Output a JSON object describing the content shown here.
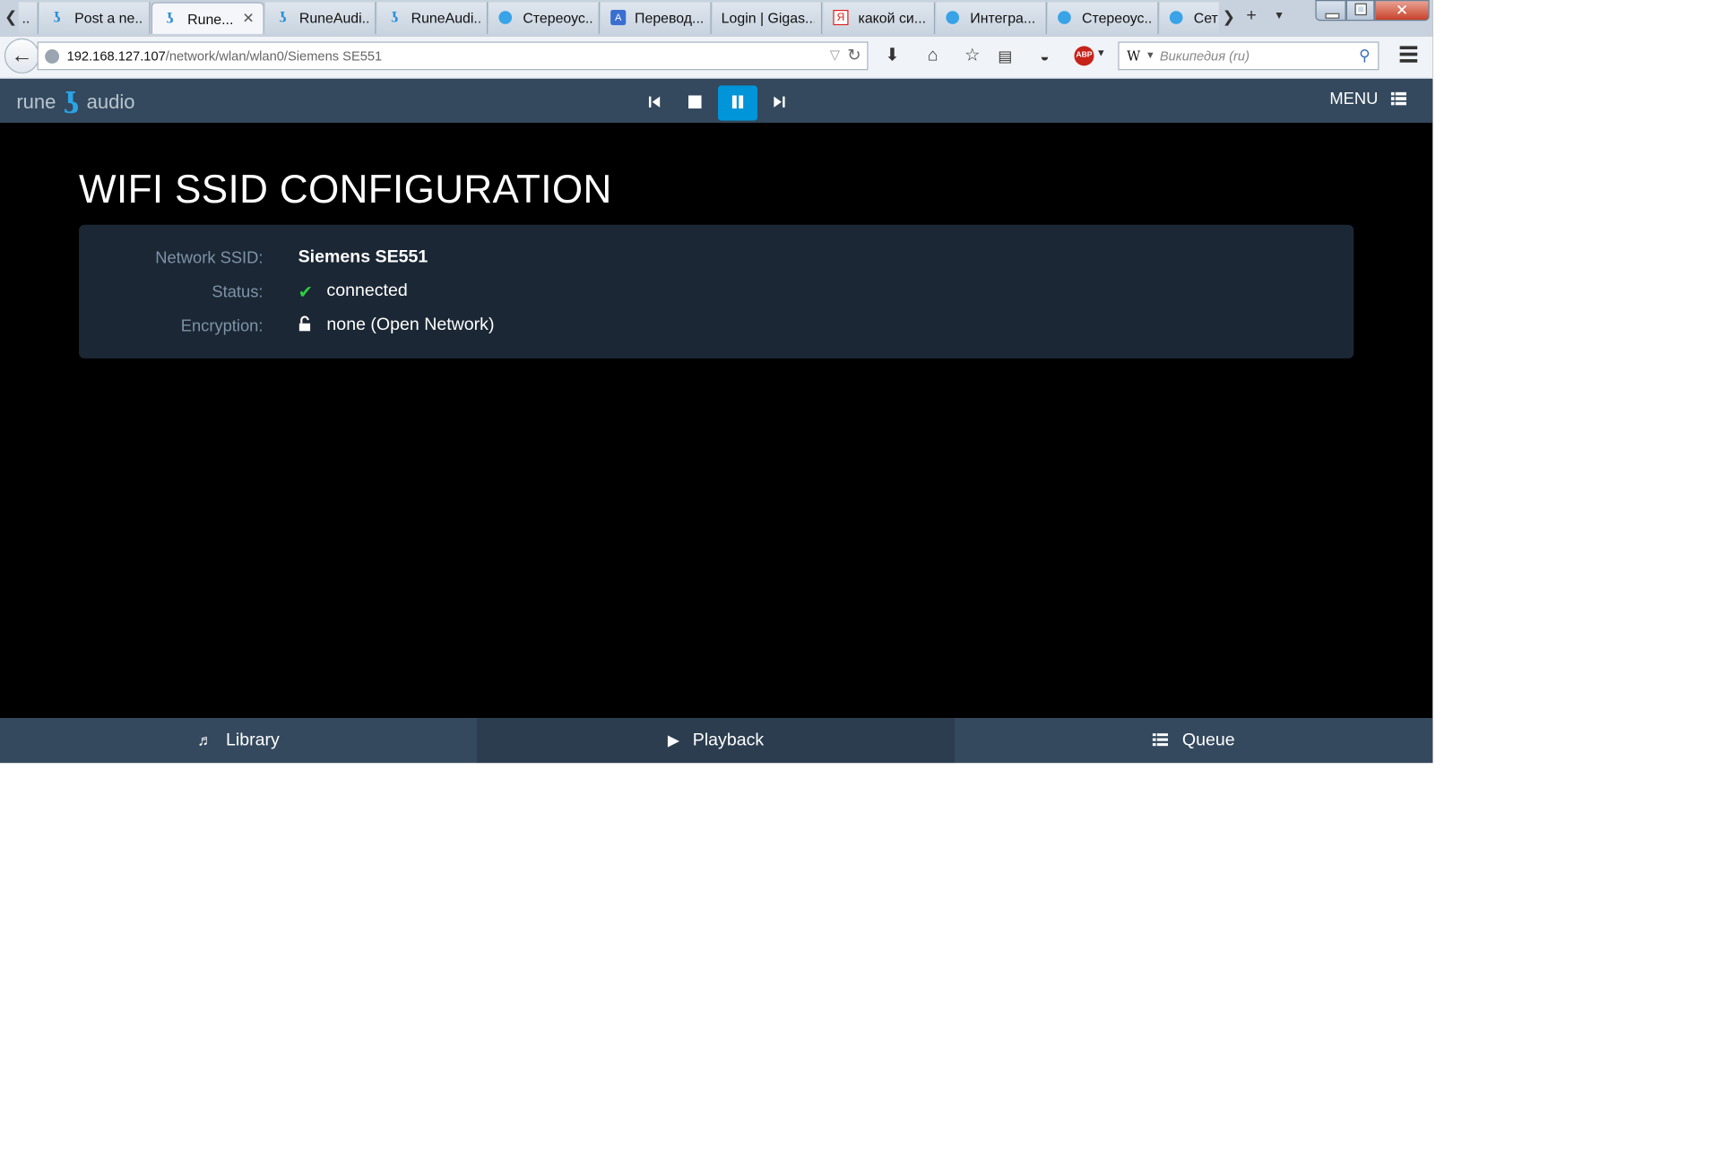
{
  "browser": {
    "tabs": [
      {
        "label": "..",
        "icon": "generic-tab-icon"
      },
      {
        "label": "Post a ne...",
        "icon": "rune-favicon-icon"
      },
      {
        "label": "Rune...",
        "icon": "rune-favicon-icon",
        "active": true
      },
      {
        "label": "RuneAudi...",
        "icon": "rune-favicon-icon"
      },
      {
        "label": "RuneAudi...",
        "icon": "rune-favicon-icon"
      },
      {
        "label": "Стереоус...",
        "icon": "globe-favicon-icon"
      },
      {
        "label": "Перевод...",
        "icon": "translate-favicon-icon"
      },
      {
        "label": "Login | Gigas...",
        "icon": "none"
      },
      {
        "label": "какой си...",
        "icon": "yandex-favicon-icon"
      },
      {
        "label": "Интегра...",
        "icon": "globe-favicon-icon"
      },
      {
        "label": "Стереоус...",
        "icon": "globe-favicon-icon"
      },
      {
        "label": "Сет",
        "icon": "globe-favicon-icon"
      }
    ],
    "tab_close_glyph": "✕",
    "new_tab_glyph": "+",
    "url": {
      "host": "192.168.127.107",
      "path": "/network/wlan/wlan0/Siemens SE551"
    },
    "search": {
      "engine_glyph": "W",
      "placeholder": "Википедия (ru)"
    },
    "abp_label": "ABP",
    "window_close_glyph": "✕"
  },
  "app": {
    "brand_left": "rune",
    "brand_right": "audio",
    "brand_mark": "ʖ",
    "menu_label": "MENU",
    "controls": [
      {
        "name": "previous-button",
        "icon": "skip-back-icon"
      },
      {
        "name": "stop-button",
        "icon": "stop-icon"
      },
      {
        "name": "pause-button",
        "icon": "pause-icon",
        "active": true
      },
      {
        "name": "next-button",
        "icon": "skip-forward-icon"
      }
    ]
  },
  "page": {
    "title": "WIFI SSID CONFIGURATION",
    "rows": [
      {
        "label": "Network SSID:",
        "value": "Siemens SE551",
        "icon": "none"
      },
      {
        "label": "Status:",
        "value": "connected",
        "icon": "check-icon"
      },
      {
        "label": "Encryption:",
        "value": "none (Open Network)",
        "icon": "unlock-icon"
      }
    ]
  },
  "footer": {
    "library_label": "Library",
    "playback_label": "Playback",
    "queue_label": "Queue"
  },
  "colors": {
    "header_bg": "#34495e",
    "accent": "#0095d8",
    "card_bg": "#1b2734",
    "label": "#7f93a8",
    "status_ok": "#2ecc40"
  }
}
